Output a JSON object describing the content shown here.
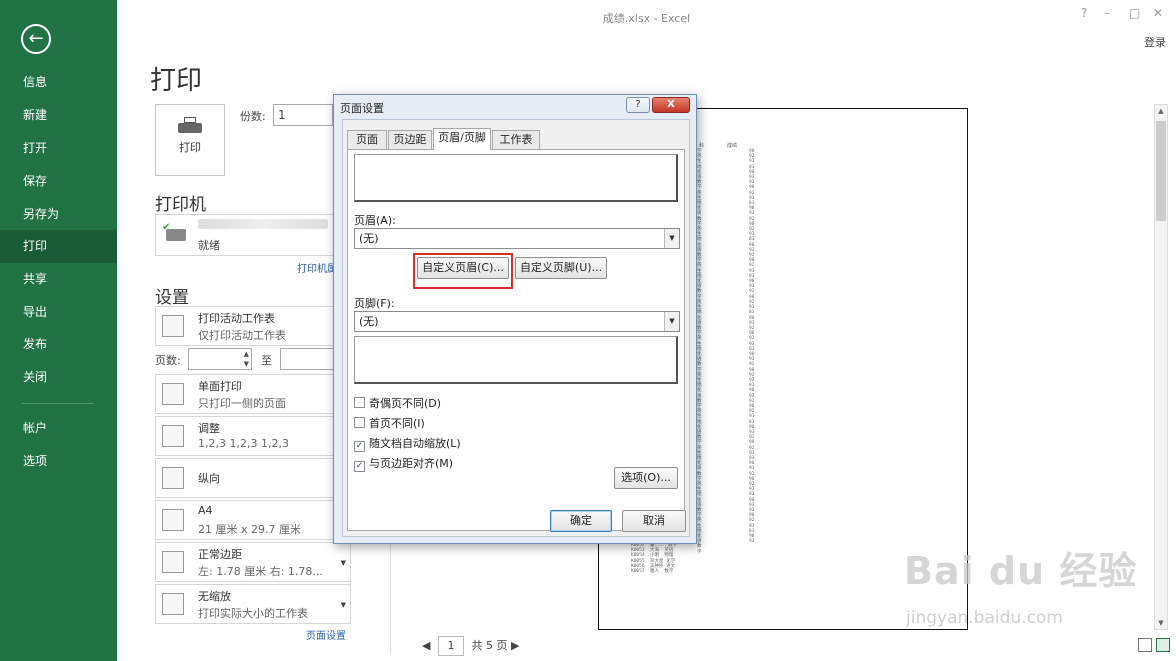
{
  "window": {
    "title": "成绩.xlsx - Excel",
    "signin": "登录",
    "help": "?",
    "minimize": "–",
    "restore": "□",
    "close": "✕"
  },
  "nav": {
    "back_icon": "back-arrow-icon",
    "items": [
      {
        "label": "信息"
      },
      {
        "label": "新建"
      },
      {
        "label": "打开"
      },
      {
        "label": "保存"
      },
      {
        "label": "另存为"
      },
      {
        "label": "打印"
      },
      {
        "label": "共享"
      },
      {
        "label": "导出"
      },
      {
        "label": "发布"
      },
      {
        "label": "关闭"
      },
      {
        "label": "帐户"
      },
      {
        "label": "选项"
      }
    ],
    "active": "打印",
    "accent": "#217346"
  },
  "print": {
    "title": "打印",
    "print_button": "打印",
    "copies_label": "份数:",
    "copies_value": "1",
    "printer_heading": "打印机",
    "printer_status": "就绪",
    "printer_props_link": "打印机属性",
    "settings_heading": "设置",
    "settings": [
      {
        "line1": "打印活动工作表",
        "line2": "仅打印活动工作表"
      },
      {
        "line1": "单面打印",
        "line2": "只打印一侧的页面"
      },
      {
        "line1": "调整",
        "line2": "1,2,3    1,2,3    1,2,3"
      },
      {
        "line1": "纵向",
        "line2": ""
      },
      {
        "line1": "A4",
        "line2": "21 厘米 x 29.7 厘米"
      },
      {
        "line1": "正常边距",
        "line2": "左: 1.78 厘米    右: 1.78..."
      },
      {
        "line1": "无缩放",
        "line2": "打印实际大小的工作表"
      }
    ],
    "pages_label": "页数:",
    "pages_to_label": "至",
    "page_setup_link": "页面设置"
  },
  "preview": {
    "header_cols": [
      "科",
      "成绩"
    ],
    "current_page": "1",
    "total_pages": "共 5 页",
    "prev": "◀",
    "next": "▶",
    "watermark": "Bai du 经验",
    "watermark_url": "jingyan.baidu.com"
  },
  "dialog": {
    "title": "页面设置",
    "help_button": "?",
    "close_button": "X",
    "tabs": [
      "页面",
      "页边距",
      "页眉/页脚",
      "工作表"
    ],
    "active_tab": "页眉/页脚",
    "header_label": "页眉(A):",
    "header_value": "(无)",
    "custom_header_button": "自定义页眉(C)...",
    "custom_footer_button": "自定义页脚(U)...",
    "footer_label": "页脚(F):",
    "footer_value": "(无)",
    "checkboxes": [
      {
        "label": "奇偶页不同(D)",
        "checked": false
      },
      {
        "label": "首页不同(I)",
        "checked": false
      },
      {
        "label": "随文档自动缩放(L)",
        "checked": true
      },
      {
        "label": "与页边距对齐(M)",
        "checked": true
      }
    ],
    "options_button": "选项(O)...",
    "ok_button": "确定",
    "cancel_button": "取消",
    "highlight_color": "#d9302a"
  }
}
